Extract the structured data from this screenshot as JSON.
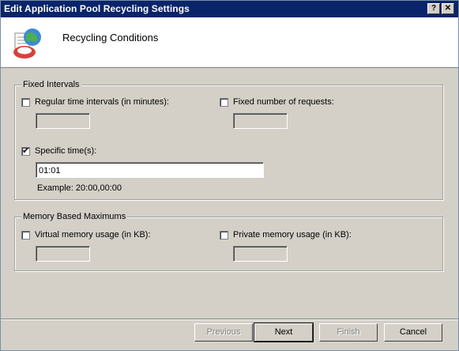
{
  "window": {
    "title": "Edit Application Pool Recycling Settings",
    "help_glyph": "?",
    "close_glyph": "✕"
  },
  "header": {
    "title": "Recycling Conditions",
    "icon": "globe-recycle-icon"
  },
  "fixed_intervals": {
    "label": "Fixed Intervals",
    "regular": {
      "label": "Regular time intervals (in minutes):",
      "checked": false,
      "value": ""
    },
    "requests": {
      "label": "Fixed number of requests:",
      "checked": false,
      "value": ""
    },
    "specific": {
      "label": "Specific time(s):",
      "checked": true,
      "value": "01:01"
    },
    "example": "Example: 20:00,00:00"
  },
  "memory": {
    "label": "Memory Based Maximums",
    "virtual": {
      "label": "Virtual memory usage (in KB):",
      "checked": false,
      "value": ""
    },
    "private": {
      "label": "Private memory usage (in KB):",
      "checked": false,
      "value": ""
    }
  },
  "buttons": {
    "previous": "Previous",
    "next": "Next",
    "finish": "Finish",
    "cancel": "Cancel"
  }
}
